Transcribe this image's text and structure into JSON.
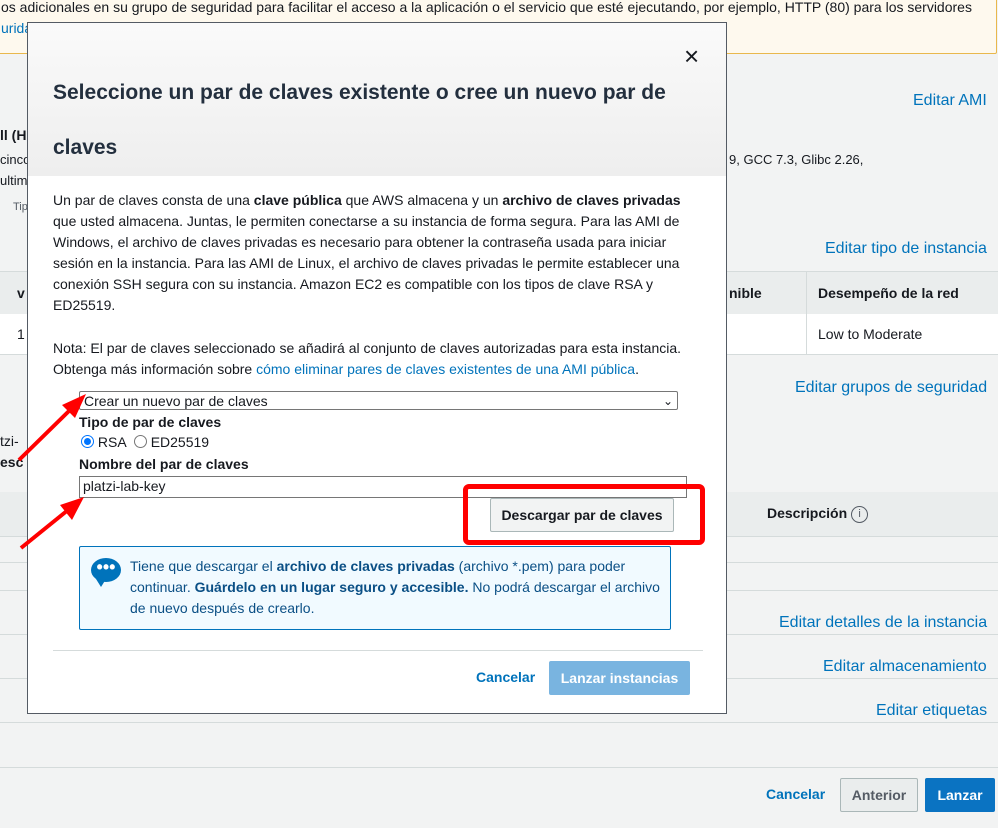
{
  "background": {
    "banner_line1": "os adicionales en su grupo de seguridad para facilitar el acceso a la aplicación o el servicio que esté ejecutando, por ejemplo, HTTP (80) para los servidores",
    "banner_line2": "uridad",
    "edit_ami": "Editar AMI",
    "ami_title": "ll (H",
    "ami_desc_line1": "cinco",
    "ami_desc_right": "9, GCC 7.3, Glibc 2.26,",
    "ami_desc_line2": "ultimo",
    "ami_type_label": "Tip",
    "edit_instance_type": "Editar tipo de instancia",
    "table_head_left": "v",
    "table_head_available": "nible",
    "table_head_network": "Desempeño de la red",
    "table_cell_left": "1",
    "table_cell_network": "Low to Moderate",
    "edit_security_groups": "Editar grupos de seguridad",
    "sg_frag1": "tzi-",
    "sg_frag2": "esc",
    "sg_head_description": "Descripción",
    "info_icon": "i",
    "edit_instance_details": "Editar detalles de la instancia",
    "edit_storage": "Editar almacenamiento",
    "edit_tags": "Editar etiquetas",
    "cancel": "Cancelar",
    "previous": "Anterior",
    "launch": "Lanzar"
  },
  "modal": {
    "title": "Seleccione un par de claves existente o cree un nuevo par de claves",
    "close": "×",
    "intro_part1": "Un par de claves consta de una ",
    "intro_bold1": "clave pública",
    "intro_part2": " que AWS almacena y un ",
    "intro_bold2": "archivo de claves privadas",
    "intro_part3": " que usted almacena. Juntas, le permiten conectarse a su instancia de forma segura. Para las AMI de Windows, el archivo de claves privadas es necesario para obtener la contraseña usada para iniciar sesión en la instancia. Para las AMI de Linux, el archivo de claves privadas le permite establecer una conexión SSH segura con su instancia. Amazon EC2 es compatible con los tipos de clave RSA y ED25519.",
    "note_text": "Nota: El par de claves seleccionado se añadirá al conjunto de claves autorizadas para esta instancia. Obtenga más información sobre ",
    "note_link": "cómo eliminar pares de claves existentes de una AMI pública",
    "note_end": ".",
    "select_value": "Crear un nuevo par de claves",
    "key_type_label": "Tipo de par de claves",
    "radio_rsa": "RSA",
    "radio_ed": "ED25519",
    "key_name_label": "Nombre del par de claves",
    "key_name_value": "platzi-lab-key",
    "download_button": "Descargar par de claves",
    "info_part1": "Tiene que descargar el ",
    "info_bold1": "archivo de claves privadas",
    "info_part2": " (archivo *.pem) para poder continuar. ",
    "info_bold2": "Guárdelo en un lugar seguro y accesible.",
    "info_part3": " No podrá descargar el archivo de nuevo después de crearlo.",
    "info_icon_glyph": "•••",
    "cancel_button": "Cancelar",
    "launch_button": "Lanzar instancias"
  },
  "colors": {
    "link": "#0073bb",
    "annotation_red": "#ff0000",
    "primary_disabled": "#79b4e0",
    "primary": "#0a73c2"
  }
}
